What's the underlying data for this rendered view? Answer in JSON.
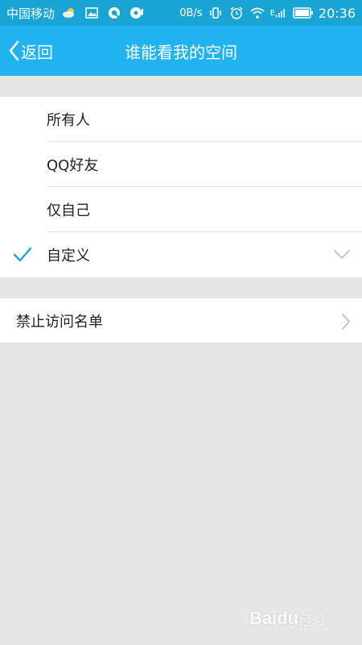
{
  "status_bar": {
    "carrier": "中国移动",
    "speed": "0B/s",
    "network": "E",
    "time": "20:36",
    "icons": [
      "weather-cloud-icon",
      "image-icon",
      "qq-browser-icon",
      "music-icon",
      "vibrate-icon",
      "alarm-icon",
      "wifi-icon",
      "signal-icon",
      "battery-icon"
    ]
  },
  "title_bar": {
    "back_label": "返回",
    "title": "谁能看我的空间"
  },
  "options": [
    {
      "label": "所有人",
      "selected": false
    },
    {
      "label": "QQ好友",
      "selected": false
    },
    {
      "label": "仅自己",
      "selected": false
    },
    {
      "label": "自定义",
      "selected": true
    }
  ],
  "blocklist": {
    "label": "禁止访问名单"
  },
  "watermark": {
    "brand": "Baidu",
    "suffix": "经验",
    "url": "jingyan.baidu.com"
  },
  "colors": {
    "status_bar": "#19a4d6",
    "title_bar": "#21b3f0",
    "accent": "#1aa3e8",
    "background": "#e6e6e6"
  }
}
